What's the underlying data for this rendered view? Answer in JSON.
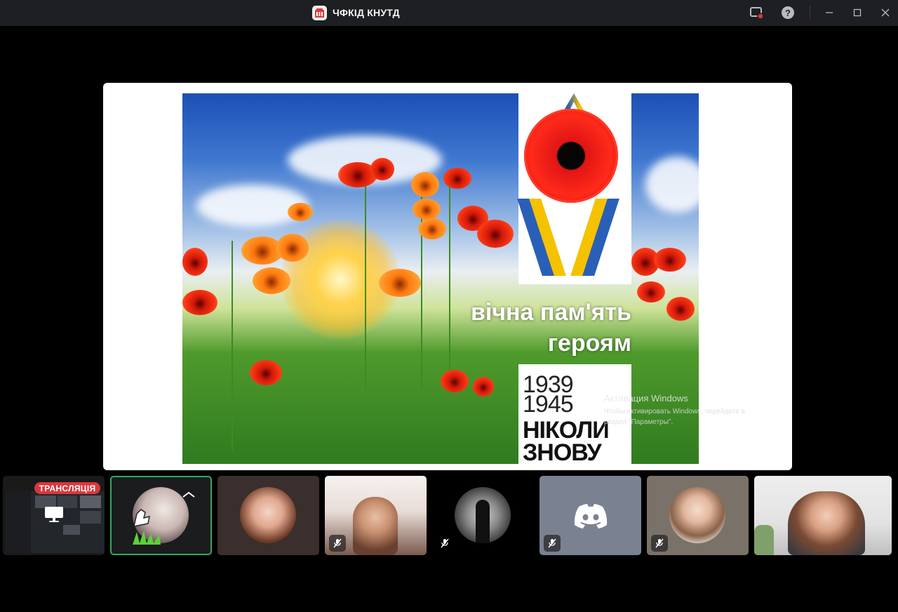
{
  "window": {
    "title": "ЧФКІД КНУТД",
    "icons": [
      "app-logo-icon",
      "screen-record-icon",
      "help-icon",
      "minimize-icon",
      "maximize-icon",
      "close-icon"
    ]
  },
  "stage": {
    "poster": {
      "tagline_line1": "вічна пам'ять",
      "tagline_line2": "героям",
      "years_line1": "1939",
      "years_line2": "1945",
      "slogan_line1": "НІКОЛИ",
      "slogan_line2": "ЗНОВУ"
    },
    "watermark": {
      "title": "Активация Windows",
      "line1": "Чтобы активировать Windows, перейдите в",
      "line2": "раздел \"Параметры\"."
    }
  },
  "participants": {
    "stream_badge": "ТРАНСЛЯЦІЯ",
    "tiles": [
      {
        "kind": "stream",
        "muted": false
      },
      {
        "kind": "avatar",
        "speaking": true,
        "muted": false
      },
      {
        "kind": "avatar",
        "muted": false
      },
      {
        "kind": "camera",
        "muted": true
      },
      {
        "kind": "avatar",
        "muted": true
      },
      {
        "kind": "default-avatar",
        "muted": true
      },
      {
        "kind": "avatar",
        "muted": true
      },
      {
        "kind": "camera",
        "muted": false
      }
    ]
  },
  "colors": {
    "titlebar": "#1e1f22",
    "background": "#000000",
    "speaking_border": "#3ba55d",
    "live_badge": "#da373c",
    "discord_tile": "#7a8191"
  }
}
